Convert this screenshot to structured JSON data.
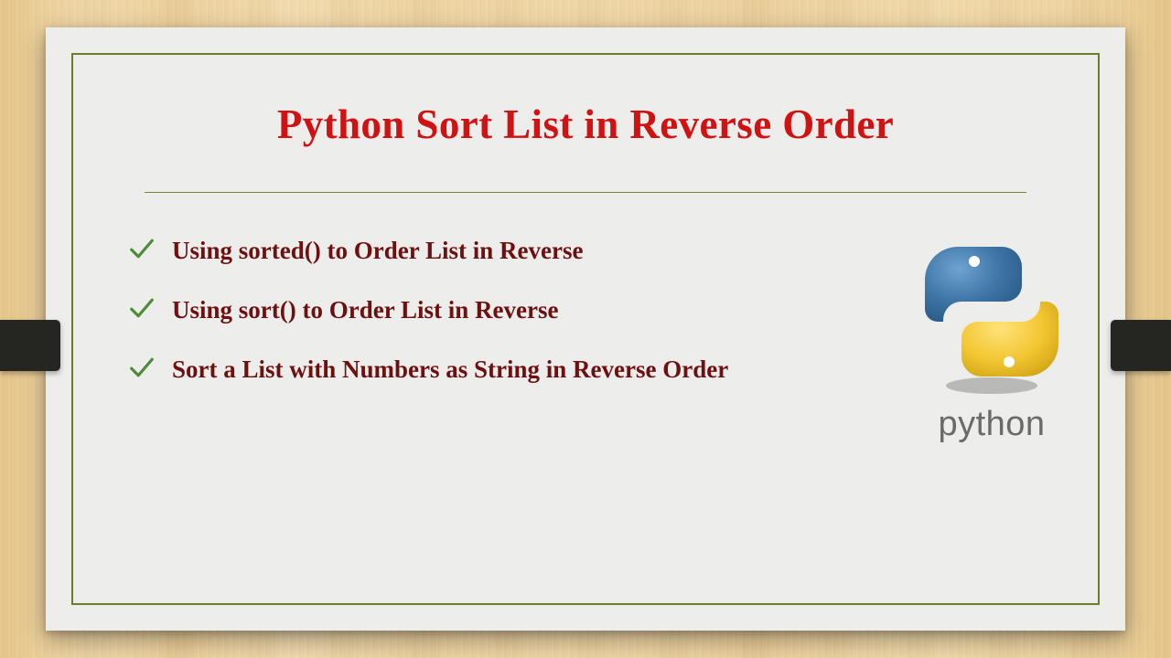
{
  "title": "Python Sort List in Reverse Order",
  "bullets": [
    "Using sorted() to Order List in Reverse",
    "Using sort() to Order List in Reverse",
    "Sort a List with Numbers as String in Reverse Order"
  ],
  "logo_caption": "python",
  "colors": {
    "title": "#d01212",
    "bullet_text": "#6e1010",
    "border": "#6a7d2a",
    "check": "#4e8b3a"
  }
}
